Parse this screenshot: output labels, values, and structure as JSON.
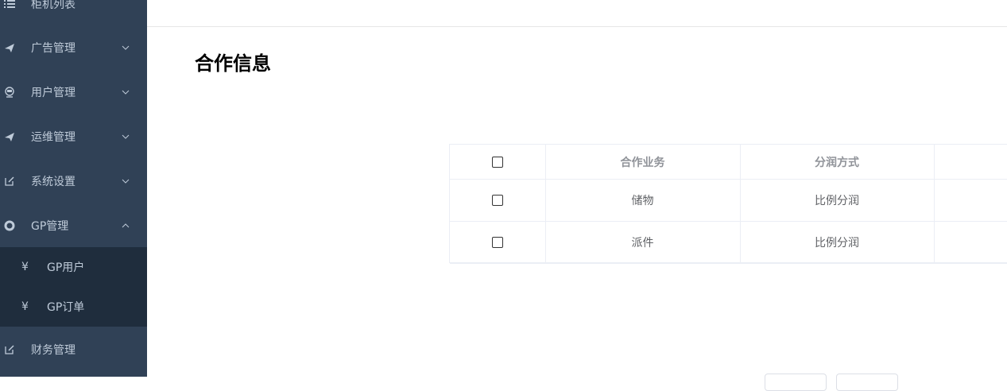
{
  "sidebar": {
    "items": [
      {
        "label": "柜机列表",
        "icon": "list-icon"
      },
      {
        "label": "广告管理",
        "icon": "paper-plane-icon"
      },
      {
        "label": "用户管理",
        "icon": "user-icon"
      },
      {
        "label": "运维管理",
        "icon": "paper-plane-icon"
      },
      {
        "label": "系统设置",
        "icon": "edit-icon"
      },
      {
        "label": "GP管理",
        "icon": "lifebuoy-icon"
      },
      {
        "label": "财务管理",
        "icon": "edit-icon"
      }
    ],
    "sub_items": [
      {
        "label": "GP用户",
        "icon": "¥"
      },
      {
        "label": "GP订单",
        "icon": "¥"
      }
    ]
  },
  "main": {
    "title": "合作信息",
    "table": {
      "headers": [
        "合作业务",
        "分润方式"
      ],
      "rows": [
        {
          "business": "储物",
          "method": "比例分润"
        },
        {
          "business": "派件",
          "method": "比例分润"
        }
      ]
    }
  },
  "colors": {
    "sidebar_bg": "#304156",
    "submenu_bg": "#1f2d3d",
    "sidebar_text": "#bfcbd9",
    "table_border": "#ebeef5"
  }
}
